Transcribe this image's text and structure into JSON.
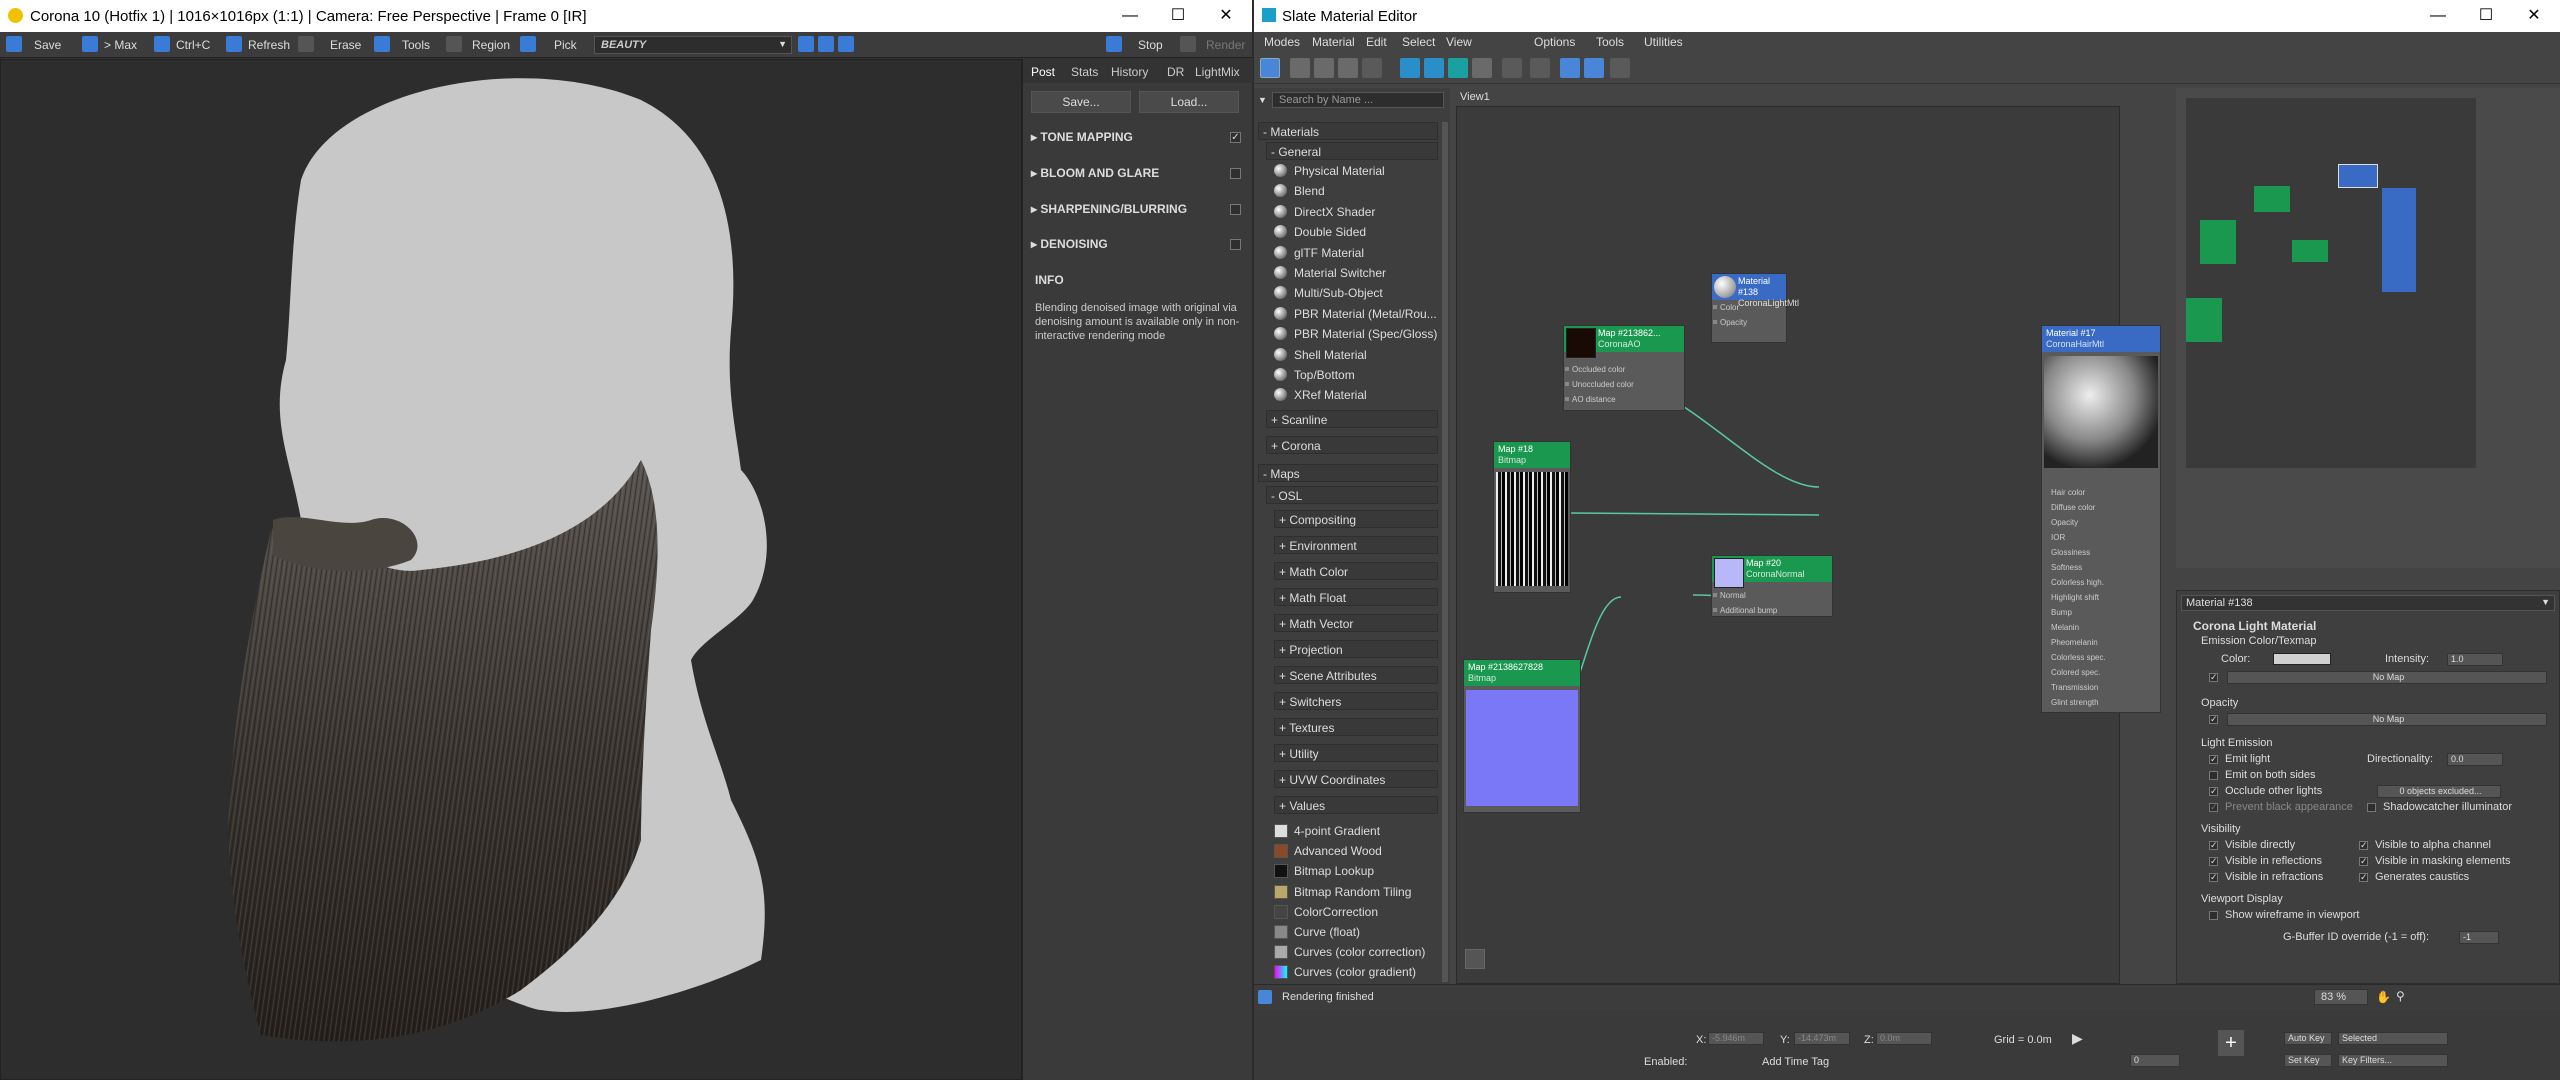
{
  "vfb": {
    "title": "Corona 10 (Hotfix 1) | 1016×1016px (1:1) | Camera: Free Perspective | Frame 0 [IR]",
    "toolbar": {
      "save": "Save",
      "to_max": "> Max",
      "copy": "Ctrl+C",
      "refresh": "Refresh",
      "erase": "Erase",
      "tools": "Tools",
      "region": "Region",
      "pick": "Pick",
      "channel": "BEAUTY",
      "stop": "Stop",
      "render": "Render"
    },
    "tabs": [
      "Post",
      "Stats",
      "History",
      "DR",
      "LightMix"
    ],
    "save_btn": "Save...",
    "load_btn": "Load...",
    "sections": [
      {
        "label": "TONE MAPPING",
        "checked": true
      },
      {
        "label": "BLOOM AND GLARE",
        "checked": false
      },
      {
        "label": "SHARPENING/BLURRING",
        "checked": false
      },
      {
        "label": "DENOISING",
        "checked": false
      }
    ],
    "info_title": "INFO",
    "info_text": "Blending denoised image with original via denoising amount is available only in non-interactive rendering mode"
  },
  "sme": {
    "title": "Slate Material Editor",
    "menu": [
      "Modes",
      "Material",
      "Edit",
      "Select",
      "View",
      "Options",
      "Tools",
      "Utilities"
    ],
    "search_placeholder": "Search by Name ...",
    "browser": {
      "materials": "- Materials",
      "general": "- General",
      "general_items": [
        "Physical Material",
        "Blend",
        "DirectX Shader",
        "Double Sided",
        "glTF Material",
        "Material Switcher",
        "Multi/Sub-Object",
        "PBR Material (Metal/Rou...",
        "PBR Material (Spec/Gloss)",
        "Shell Material",
        "Top/Bottom",
        "XRef Material"
      ],
      "scanline": "+ Scanline",
      "corona": "+ Corona",
      "maps": "- Maps",
      "osl": "- OSL",
      "osl_items": [
        "+ Compositing",
        "+ Environment",
        "+ Math Color",
        "+ Math Float",
        "+ Math Vector",
        "+ Projection",
        "+ Scene Attributes",
        "+ Switchers",
        "+ Textures",
        "+ Utility",
        "+ UVW Coordinates",
        "+ Values"
      ],
      "map_items": [
        "4-point Gradient",
        "Advanced Wood",
        "Bitmap Lookup",
        "Bitmap Random Tiling",
        "ColorCorrection",
        "Curve (float)",
        "Curves (color correction)",
        "Curves (color gradient)"
      ]
    },
    "view_tab": "View1",
    "nodes": {
      "light": {
        "title": "Material #138",
        "sub": "CoronaLightMtl",
        "ports": [
          "Color",
          "Opacity"
        ]
      },
      "ao": {
        "title": "Map #213862...",
        "sub": "CoronaAO",
        "ports": [
          "Occluded color",
          "Unoccluded color",
          "AO distance"
        ]
      },
      "bitmap18": {
        "title": "Map #18",
        "sub": "Bitmap"
      },
      "normal": {
        "title": "Map #20",
        "sub": "CoronaNormal",
        "ports": [
          "Normal",
          "Additional bump"
        ]
      },
      "bitmap2": {
        "title": "Map #2138627828",
        "sub": "Bitmap"
      },
      "hair": {
        "title": "Material #17",
        "sub": "CoronaHairMtl",
        "ports": [
          "Hair color",
          "Diffuse color",
          "Opacity",
          "IOR",
          "Glossiness",
          "Softness",
          "Colorless high.",
          "Highlight shift",
          "Bump",
          "Melanin",
          "Pheomelanin",
          "Colorless spec.",
          "Colored spec.",
          "Transmission",
          "Glint strength"
        ]
      }
    },
    "params": {
      "header": "Material #138",
      "rollout": "Corona Light Material",
      "emission_title": "Emission Color/Texmap",
      "color_label": "Color:",
      "intensity_label": "Intensity:",
      "intensity": "1.0",
      "no_map": "No Map",
      "opacity_title": "Opacity",
      "light_emission_title": "Light Emission",
      "emit_light": "Emit light",
      "directionality_label": "Directionality:",
      "directionality": "0.0",
      "emit_both": "Emit on both sides",
      "occlude": "Occlude other lights",
      "objects_excluded": "0 objects excluded...",
      "prevent_black": "Prevent black appearance",
      "shadowcatcher": "Shadowcatcher illuminator",
      "visibility_title": "Visibility",
      "visible_directly": "Visible directly",
      "visible_alpha": "Visible to alpha channel",
      "visible_reflections": "Visible in reflections",
      "visible_masking": "Visible in masking elements",
      "visible_refractions": "Visible in refractions",
      "generates_caustics": "Generates caustics",
      "viewport_title": "Viewport Display",
      "show_wireframe": "Show wireframe in viewport",
      "gbuffer_label": "G-Buffer ID override (-1 = off):",
      "gbuffer": "-1"
    },
    "status": "Rendering finished",
    "zoom": "83 %"
  },
  "bottom": {
    "x_label": "X:",
    "x_value": "-5.946m",
    "y_label": "Y:",
    "y_value": "-14.473m",
    "z_label": "Z:",
    "z_value": "0.0m",
    "grid": "Grid = 0.0m",
    "frame": "0",
    "auto_key": "Auto Key",
    "selected": "Selected",
    "set_key": "Set Key",
    "key_filters": "Key Filters...",
    "enabled": "Enabled:",
    "add_time_tag": "Add Time Tag"
  },
  "colors": {
    "accent": "#3a7bd5",
    "node_green": "#1a9850",
    "node_blue": "#3a6bc4"
  }
}
